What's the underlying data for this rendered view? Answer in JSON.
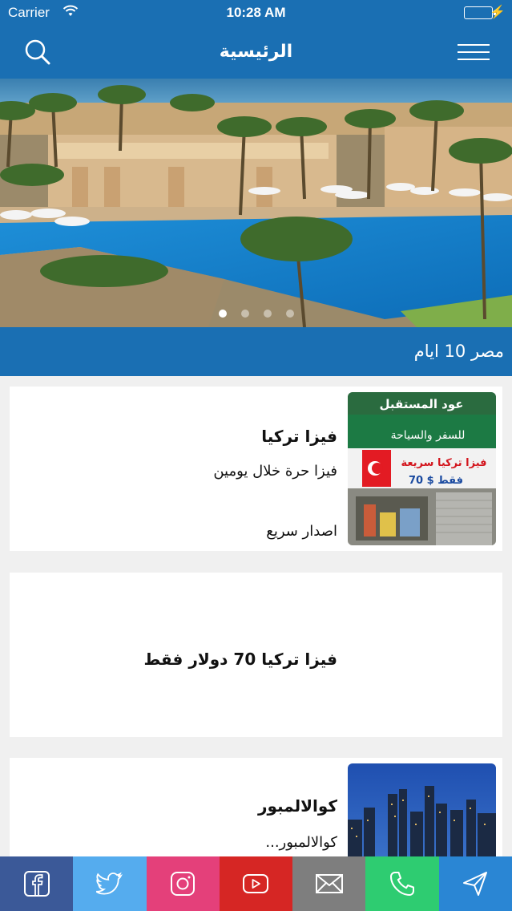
{
  "status_bar": {
    "carrier": "Carrier",
    "time": "10:28 AM"
  },
  "nav": {
    "title": "الرئيسية",
    "search_icon": "search-icon",
    "menu_icon": "hamburger-menu-icon"
  },
  "banner": {
    "caption": "مصر 10 ايام",
    "slide_count": 4,
    "active_slide": 1
  },
  "cards": [
    {
      "title": "فيزا تركيا",
      "line1": "فيزا حرة خلال يومين",
      "line2": "اصدار سريع",
      "thumb": {
        "sign_top": "عود المستقبل",
        "sign_sub": "للسفر والسياحة",
        "sign_red": "فيزا تركيا سريعة",
        "sign_price": "70 $ فقط"
      }
    },
    {
      "title": "فيزا تركيا 70 دولار فقط"
    },
    {
      "title": "كوالالمبور",
      "line1": "كوالالمبور..."
    }
  ],
  "social": [
    {
      "name": "facebook",
      "icon": "facebook-icon",
      "color": "#3b5998"
    },
    {
      "name": "twitter",
      "icon": "twitter-icon",
      "color": "#55acee"
    },
    {
      "name": "instagram",
      "icon": "instagram-icon",
      "color": "#e4407a"
    },
    {
      "name": "youtube",
      "icon": "youtube-icon",
      "color": "#d62624"
    },
    {
      "name": "email",
      "icon": "mail-icon",
      "color": "#7e7e7e"
    },
    {
      "name": "phone",
      "icon": "phone-icon",
      "color": "#2ecc71"
    },
    {
      "name": "share",
      "icon": "send-icon",
      "color": "#2a86d4"
    }
  ],
  "colors": {
    "primary": "#1a6fb3",
    "battery": "#4cd964"
  }
}
